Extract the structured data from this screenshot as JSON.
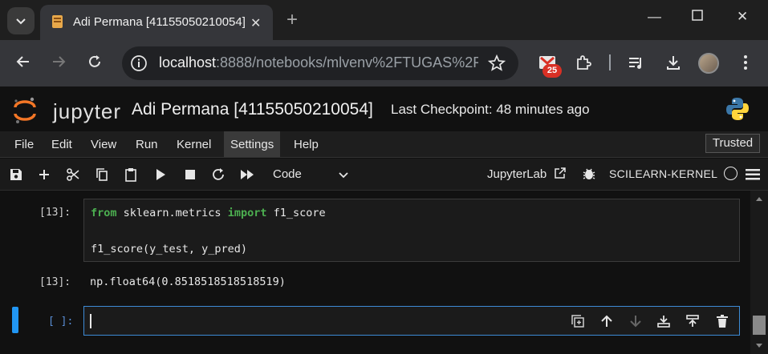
{
  "browser": {
    "tab_title": "Adi Permana [41155050210054]",
    "url_host": "localhost",
    "url_rest": ":8888/notebooks/mlvenv%2FTUGAS%2F...",
    "extension_badge": "25",
    "icons": [
      "tab-search-icon",
      "notebook-favicon",
      "close-icon",
      "plus-icon",
      "minimize-icon",
      "maximize-icon",
      "close-window-icon",
      "back-icon",
      "forward-icon",
      "reload-icon",
      "info-icon",
      "star-icon",
      "extension-icon",
      "puzzle-icon",
      "media-icon",
      "download-icon",
      "profile-avatar",
      "kebab-menu-icon"
    ]
  },
  "jupyter": {
    "logo_text": "jupyter",
    "notebook_title": "Adi Permana [41155050210054]",
    "checkpoint": "Last Checkpoint: 48 minutes ago",
    "menu": [
      "File",
      "Edit",
      "View",
      "Run",
      "Kernel",
      "Settings",
      "Help"
    ],
    "active_menu": "Settings",
    "trusted_label": "Trusted",
    "cell_type": "Code",
    "lab_link": "JupyterLab",
    "kernel_name": "SCILEARN-KERNEL"
  },
  "cells": [
    {
      "prompt": "[13]:",
      "code_line1_kw1": "from",
      "code_line1_mid": " sklearn.metrics ",
      "code_line1_kw2": "import",
      "code_line1_end": " f1_score",
      "code_line3": "f1_score(y_test, y_pred)",
      "output_prompt": "[13]:",
      "output": "np.float64(0.8518518518518519)"
    },
    {
      "prompt": "[ ]:"
    }
  ],
  "colors": {
    "accent": "#2196f3",
    "keyword": "#4caf50",
    "badge": "#d93025",
    "bg": "#111111"
  }
}
